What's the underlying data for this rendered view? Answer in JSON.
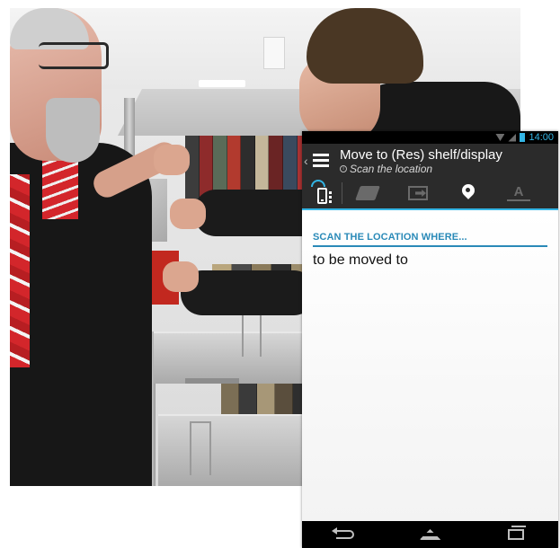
{
  "status_bar": {
    "time": "14:00",
    "icons": [
      "wifi-icon",
      "signal-icon",
      "battery-icon"
    ]
  },
  "action_bar": {
    "back_glyph": "‹",
    "title": "Move to (Res) shelf/display",
    "subtitle": "Scan the location",
    "info_glyph": "i"
  },
  "toolbar": {
    "icons": [
      "device-scan-icon",
      "book-icon",
      "move-out-icon",
      "location-pin-icon",
      "text-icon"
    ],
    "active": "location-pin-icon",
    "text_icon_glyph": "A"
  },
  "content": {
    "section_header": "SCAN THE LOCATION WHERE...",
    "body": "to be moved to"
  },
  "nav_bar": {
    "icons": [
      "back-icon",
      "home-icon",
      "recent-apps-icon"
    ]
  },
  "colors": {
    "accent": "#33b5e5",
    "section_header": "#2a8ab8",
    "action_bar": "#2b2b2b",
    "status_bar": "#000000"
  }
}
